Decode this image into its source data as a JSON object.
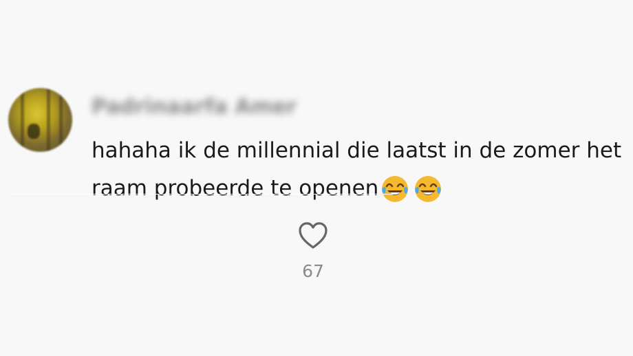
{
  "comment": {
    "username": "Padrinaarfa Amer",
    "text": "hahaha ik de millennial die laatst in de zomer het raam probeerde te openen",
    "emojis": [
      "face-with-tears-of-joy-icon",
      "face-with-tears-of-joy-icon"
    ],
    "like_icon": "heart-outline-icon",
    "like_count": "67"
  },
  "colors": {
    "background": "#f8f8f8",
    "text": "#1a1a1a",
    "muted": "#8a8a8a",
    "emoji_face": "#f5b92e"
  }
}
